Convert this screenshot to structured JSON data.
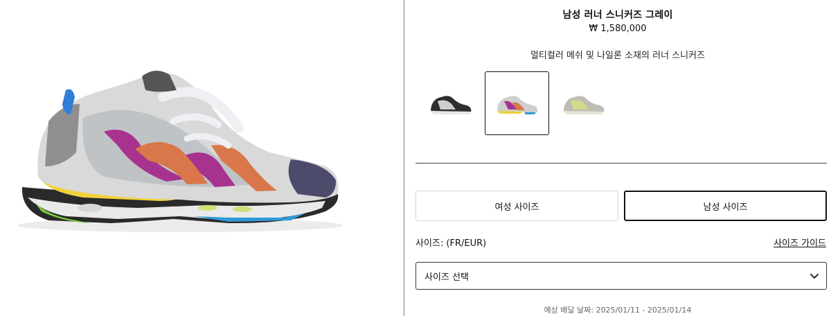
{
  "product": {
    "title": "남성 러너 스니커즈 그레이",
    "price": "₩ 1,580,000",
    "description": "멀티컬러 메쉬 및 나일론 소재의 러너 스니커즈"
  },
  "thumbnails": [
    {
      "label": "black variant",
      "selected": false
    },
    {
      "label": "multicolor variant",
      "selected": true
    },
    {
      "label": "yellow variant",
      "selected": false
    }
  ],
  "size_tabs": {
    "women": "여성 사이즈",
    "men": "남성 사이즈",
    "active": "men"
  },
  "size": {
    "label": "사이즈: (FR/EUR)",
    "guide_link": "사이즈 가이드",
    "select_placeholder": "사이즈 선택"
  },
  "delivery": {
    "text": "예상 배달 날짜: 2025/01/11 - 2025/01/14"
  },
  "colors": {
    "accent": "#111111",
    "border_light": "#d4d4d4",
    "muted_text": "#666666"
  }
}
